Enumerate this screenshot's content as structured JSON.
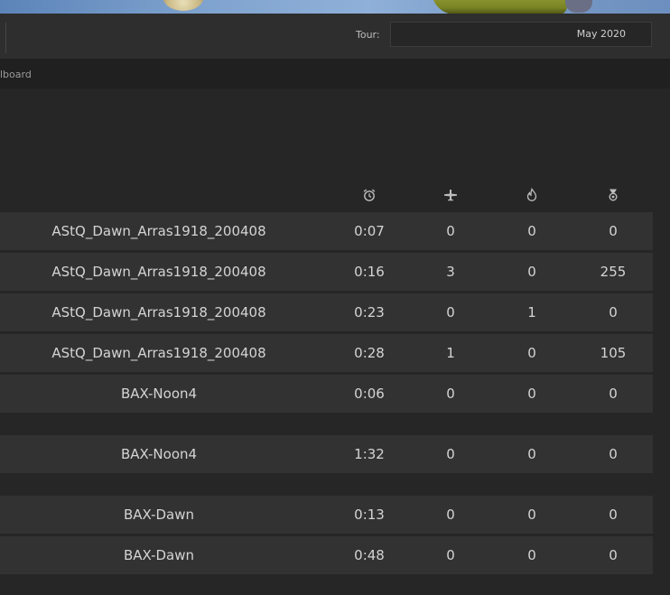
{
  "toolbar": {
    "tour_label": "Tour:",
    "tour_value": "May 2020"
  },
  "breadcrumb": {
    "text": "lboard"
  },
  "table": {
    "icons": [
      "alarm-clock-icon",
      "airplane-icon",
      "fire-icon",
      "medal-icon"
    ],
    "rows": [
      {
        "name": "AStQ_Dawn_Arras1918_200408",
        "time": "0:07",
        "air_kills": "0",
        "ground_kills": "0",
        "score": "0"
      },
      {
        "name": "AStQ_Dawn_Arras1918_200408",
        "time": "0:16",
        "air_kills": "3",
        "ground_kills": "0",
        "score": "255"
      },
      {
        "name": "AStQ_Dawn_Arras1918_200408",
        "time": "0:23",
        "air_kills": "0",
        "ground_kills": "1",
        "score": "0"
      },
      {
        "name": "AStQ_Dawn_Arras1918_200408",
        "time": "0:28",
        "air_kills": "1",
        "ground_kills": "0",
        "score": "105"
      },
      {
        "name": "BAX-Noon4",
        "time": "0:06",
        "air_kills": "0",
        "ground_kills": "0",
        "score": "0"
      },
      {
        "name": "BAX-Noon4",
        "time": "1:32",
        "air_kills": "0",
        "ground_kills": "0",
        "score": "0"
      },
      {
        "name": "BAX-Dawn",
        "time": "0:13",
        "air_kills": "0",
        "ground_kills": "0",
        "score": "0"
      },
      {
        "name": "BAX-Dawn",
        "time": "0:48",
        "air_kills": "0",
        "ground_kills": "0",
        "score": "0"
      }
    ]
  }
}
